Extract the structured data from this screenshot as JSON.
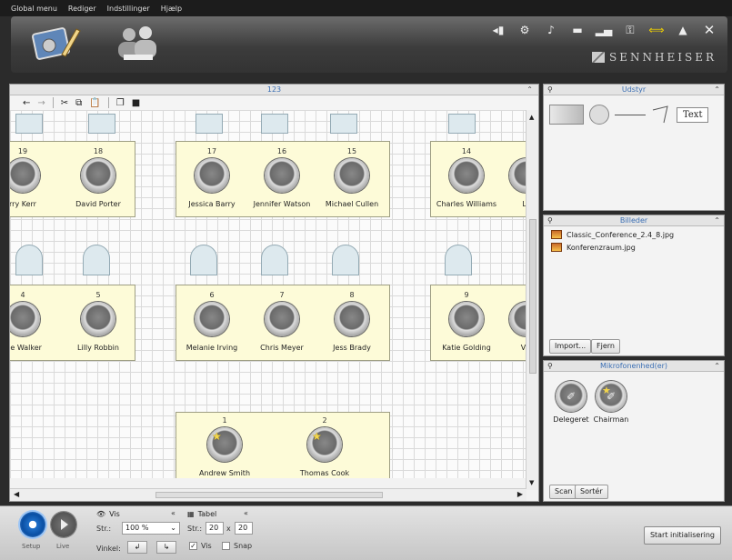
{
  "menu": [
    "Global menu",
    "Rediger",
    "Indstillinger",
    "Hjælp"
  ],
  "brand": "SENNHEISER",
  "workspace": {
    "title": "123"
  },
  "canvas": {
    "top_row_tables": [
      {
        "seats": [
          {
            "num": "19",
            "name": "rry Kerr"
          },
          {
            "num": "18",
            "name": "David Porter"
          }
        ]
      },
      {
        "seats": [
          {
            "num": "17",
            "name": "Jessica Barry"
          },
          {
            "num": "16",
            "name": "Jennifer Watson"
          },
          {
            "num": "15",
            "name": "Michael Cullen"
          }
        ]
      },
      {
        "seats": [
          {
            "num": "14",
            "name": "Charles Williams"
          },
          {
            "num": "",
            "name": "Lu"
          }
        ]
      }
    ],
    "middle_row_tables": [
      {
        "seats": [
          {
            "num": "4",
            "name": "nie Walker"
          },
          {
            "num": "5",
            "name": "Lilly Robbin"
          }
        ]
      },
      {
        "seats": [
          {
            "num": "6",
            "name": "Melanie Irving"
          },
          {
            "num": "7",
            "name": "Chris Meyer"
          },
          {
            "num": "8",
            "name": "Jess Brady"
          }
        ]
      },
      {
        "seats": [
          {
            "num": "9",
            "name": "Katie Golding"
          },
          {
            "num": "",
            "name": "Vin"
          }
        ]
      }
    ],
    "chair_table": {
      "seats": [
        {
          "num": "1",
          "name": "Andrew Smith"
        },
        {
          "num": "2",
          "name": "Thomas Cook"
        }
      ]
    }
  },
  "panels": {
    "udstyr": {
      "title": "Udstyr",
      "text_tool": "Text"
    },
    "billeder": {
      "title": "Billeder",
      "files": [
        "Classic_Conference_2.4_8.jpg",
        "Konferenzraum.jpg"
      ],
      "import_label": "Import...",
      "remove_label": "Fjern"
    },
    "mikrofon": {
      "title": "Mikrofonenhed(er)",
      "types": [
        "Delegeret",
        "Chairman"
      ],
      "scan_label": "Scan",
      "sort_label": "Sortér"
    }
  },
  "bottom": {
    "setup_label": "Setup",
    "live_label": "Live",
    "vis_group": {
      "title": "Vis",
      "size_label": "Str.:",
      "zoom_value": "100 %",
      "angle_label": "Vinkel:"
    },
    "table_group": {
      "title": "Tabel",
      "size_label": "Str.:",
      "cols": "20",
      "x": "x",
      "rows": "20",
      "show_label": "Vis",
      "snap_label": "Snap"
    },
    "start_button": "Start initialisering"
  },
  "colors": {
    "accent": "#3b6fb4",
    "table_fill": "#fdfbd8",
    "setup_active": "#1f6fc8"
  }
}
